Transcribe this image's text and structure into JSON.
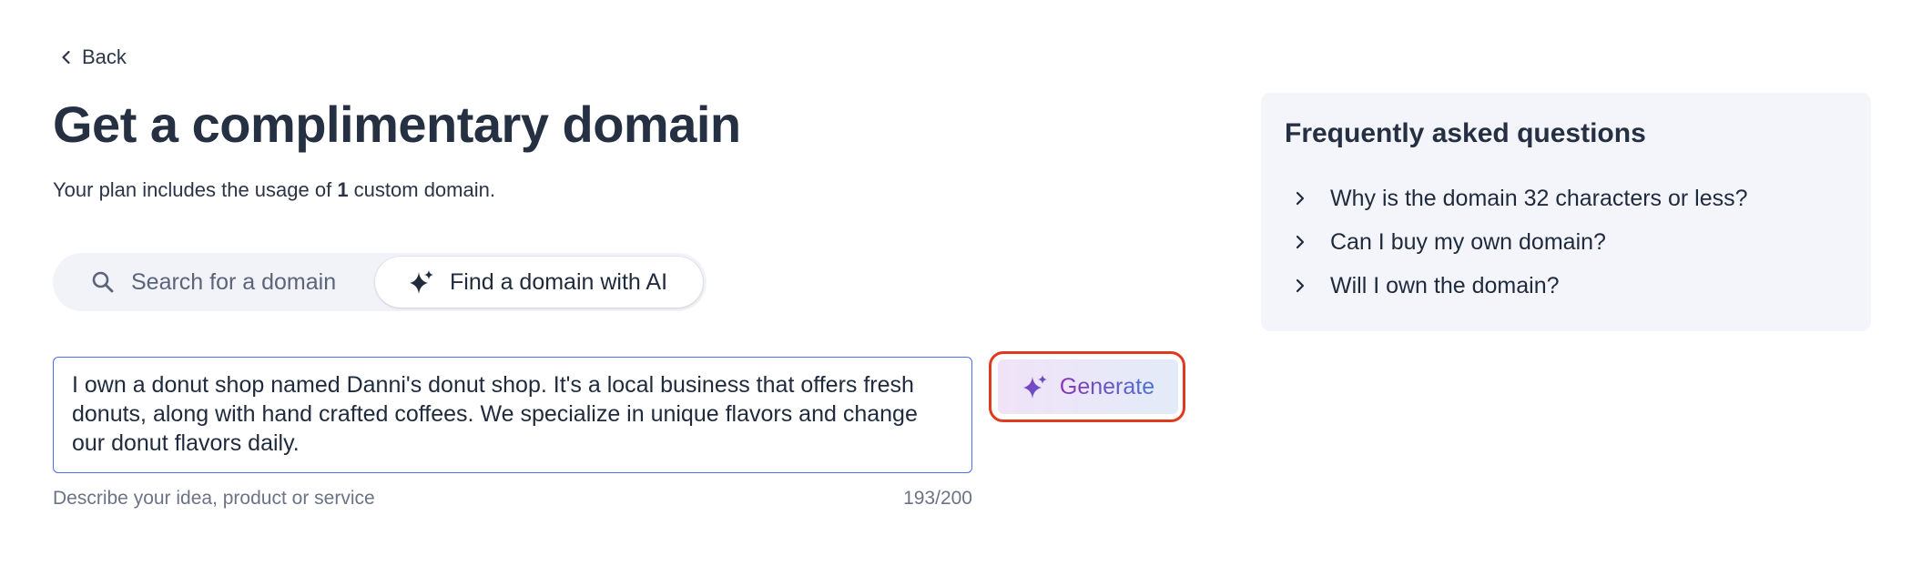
{
  "nav": {
    "back_label": "Back"
  },
  "header": {
    "title": "Get a complimentary domain",
    "plan_prefix": "Your plan includes the usage of ",
    "plan_count": "1",
    "plan_suffix": " custom domain."
  },
  "tabs": [
    {
      "label": "Search for a domain",
      "icon": "search-icon",
      "selected": false
    },
    {
      "label": "Find a domain with AI",
      "icon": "sparkle-icon",
      "selected": true
    }
  ],
  "prompt": {
    "value": "I own a donut shop named Danni's donut shop. It's a local business that offers fresh donuts, along with hand crafted coffees. We specialize in unique flavors and change our donut flavors daily.",
    "helper": "Describe your idea, product or service",
    "count": "193/200"
  },
  "generate": {
    "label": "Generate",
    "highlight_color": "#e03a1e"
  },
  "faq": {
    "title": "Frequently asked questions",
    "items": [
      "Why is the domain 32 characters or less?",
      "Can I buy my own domain?",
      "Will I own the domain?"
    ]
  },
  "colors": {
    "text": "#1f2a3d",
    "accent_blue": "#4a6cf7",
    "ai_purple": "#8a35b7",
    "panel_bg": "#f3f5fa"
  }
}
